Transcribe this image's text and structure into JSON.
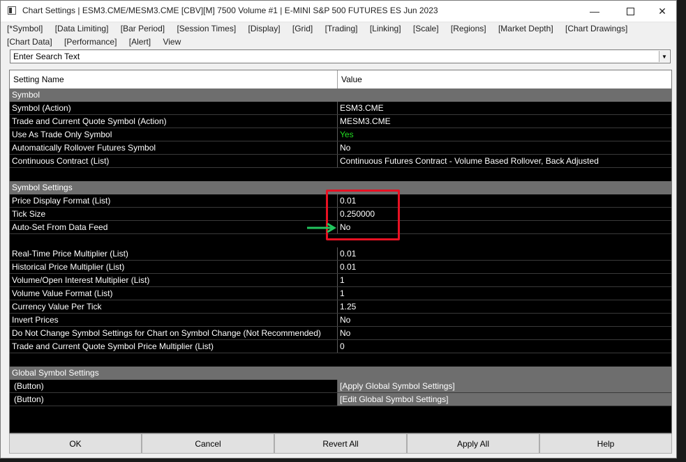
{
  "window": {
    "title": "Chart Settings | ESM3.CME/MESM3.CME [CBV][M]  7500 Volume  #1 | E-MINI S&P 500 FUTURES ES Jun 2023",
    "minimize_icon": "minimize-icon",
    "maximize_icon": "maximize-icon",
    "close_icon": "close-icon"
  },
  "menu": [
    "[*Symbol]",
    "[Data Limiting]",
    "[Bar Period]",
    "[Session Times]",
    "[Display]",
    "[Grid]",
    "[Trading]",
    "[Linking]",
    "[Scale]",
    "[Regions]",
    "[Market Depth]",
    "[Chart Drawings]",
    "[Chart Data]",
    "[Performance]",
    "[Alert]",
    "View"
  ],
  "search": {
    "value": "Enter Search Text"
  },
  "grid": {
    "header": {
      "name": "Setting Name",
      "value": "Value"
    },
    "sections": {
      "symbol": "Symbol",
      "symbol_settings": "Symbol Settings",
      "global": "Global Symbol Settings"
    },
    "symbol_rows": [
      {
        "name": "Symbol (Action)",
        "value": "ESM3.CME"
      },
      {
        "name": "Trade and Current Quote Symbol (Action)",
        "value": "MESM3.CME"
      },
      {
        "name": "Use As Trade Only Symbol",
        "value": "Yes"
      },
      {
        "name": "Automatically Rollover Futures Symbol",
        "value": "No"
      },
      {
        "name": "Continuous Contract (List)",
        "value": "Continuous Futures Contract - Volume Based Rollover, Back Adjusted"
      }
    ],
    "symbol_settings_rows": [
      {
        "name": "Price Display Format (List)",
        "value": "0.01"
      },
      {
        "name": "Tick Size",
        "value": "0.250000"
      },
      {
        "name": "Auto-Set From Data Feed",
        "value": "No"
      }
    ],
    "multiplier_rows": [
      {
        "name": "Real-Time Price Multiplier (List)",
        "value": "0.01"
      },
      {
        "name": "Historical Price Multiplier (List)",
        "value": "0.01"
      },
      {
        "name": "Volume/Open Interest Multiplier (List)",
        "value": "1"
      },
      {
        "name": "Volume Value Format (List)",
        "value": "1"
      },
      {
        "name": "Currency Value Per Tick",
        "value": "1.25"
      },
      {
        "name": "Invert Prices",
        "value": "No"
      },
      {
        "name": "Do Not Change Symbol Settings for Chart on Symbol Change (Not Recommended)",
        "value": "No"
      },
      {
        "name": "Trade and Current Quote Symbol Price Multiplier (List)",
        "value": "0"
      }
    ],
    "global_rows": [
      {
        "name": "(Button)",
        "value": "[Apply Global Symbol Settings]"
      },
      {
        "name": "(Button)",
        "value": "[Edit Global Symbol Settings]"
      }
    ]
  },
  "buttons": {
    "ok": "OK",
    "cancel": "Cancel",
    "revert": "Revert All",
    "apply": "Apply All",
    "help": "Help"
  },
  "colors": {
    "highlight": "#e81123",
    "arrow": "#22c55e",
    "yes_text": "#22dd22"
  }
}
